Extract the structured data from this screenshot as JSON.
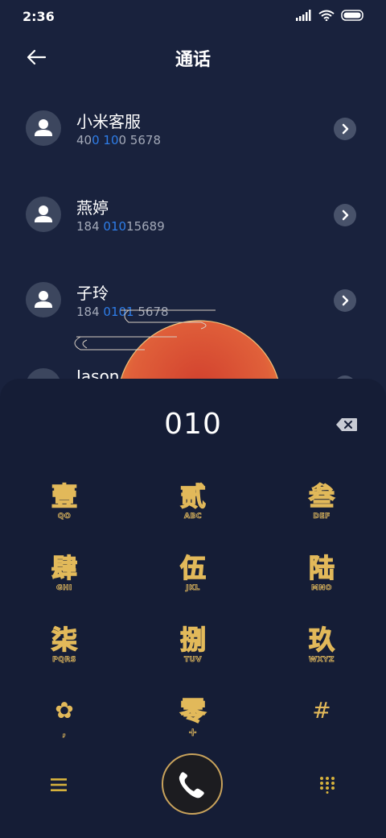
{
  "status": {
    "time": "2:36"
  },
  "header": {
    "title": "通话"
  },
  "contacts": [
    {
      "name": "小米客服",
      "number_parts": [
        "40",
        "0 10",
        "0 5678"
      ]
    },
    {
      "name": "燕婷",
      "number_parts": [
        "184 ",
        "010",
        "15689"
      ]
    },
    {
      "name": "子玲",
      "number_parts": [
        "184 ",
        "0101",
        " 5678"
      ]
    },
    {
      "name": "Jason"
    }
  ],
  "dialer": {
    "input": "010",
    "keys": [
      {
        "main": "壹",
        "sub": "QO"
      },
      {
        "main": "贰",
        "sub": "ABC"
      },
      {
        "main": "叁",
        "sub": "DEF"
      },
      {
        "main": "肆",
        "sub": "GHI"
      },
      {
        "main": "伍",
        "sub": "JKL"
      },
      {
        "main": "陆",
        "sub": "MNO"
      },
      {
        "main": "柒",
        "sub": "PQRS"
      },
      {
        "main": "捌",
        "sub": "TUV"
      },
      {
        "main": "玖",
        "sub": "WXYZ"
      },
      {
        "main": "✿",
        "sub": ","
      },
      {
        "main": "零",
        "sub": "+"
      },
      {
        "main": "#",
        "sub": ""
      }
    ]
  },
  "colors": {
    "accent_gold": "#e2b95a",
    "highlight_blue": "#2e7de8",
    "background": "#19223d"
  }
}
